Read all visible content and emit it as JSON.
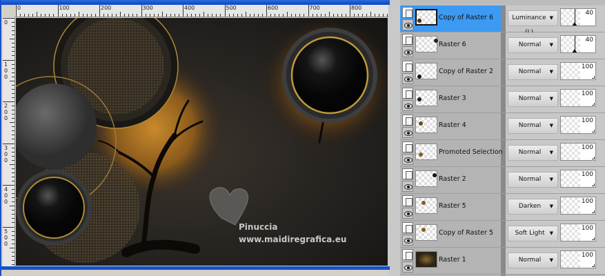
{
  "ruler": {
    "h_labels": [
      "0",
      "100",
      "200",
      "300",
      "400",
      "500",
      "600",
      "700",
      "800"
    ],
    "v_labels": [
      "0",
      "100",
      "200",
      "300",
      "400",
      "500"
    ]
  },
  "watermark": {
    "name": "Pinuccia",
    "url": "www.maidiregrafica.eu"
  },
  "colors": {
    "selected": "#3c9af2",
    "window_border": "#1651c9"
  },
  "layers": [
    {
      "name": "Copy of Raster 6",
      "blend": "Luminance (L)",
      "opacity": "40",
      "selected": true
    },
    {
      "name": "Raster 6",
      "blend": "Normal",
      "opacity": "40"
    },
    {
      "name": "Copy of Raster 2",
      "blend": "Normal",
      "opacity": "100"
    },
    {
      "name": "Raster 3",
      "blend": "Normal",
      "opacity": "100"
    },
    {
      "name": "Raster 4",
      "blend": "Normal",
      "opacity": "100"
    },
    {
      "name": "Promoted Selection",
      "blend": "Normal",
      "opacity": "100"
    },
    {
      "name": "Raster 2",
      "blend": "Normal",
      "opacity": "100"
    },
    {
      "name": "Raster 5",
      "blend": "Darken",
      "opacity": "100"
    },
    {
      "name": "Copy of Raster 5",
      "blend": "Soft Light",
      "opacity": "100"
    },
    {
      "name": "Raster 1",
      "blend": "Normal",
      "opacity": "100"
    }
  ]
}
